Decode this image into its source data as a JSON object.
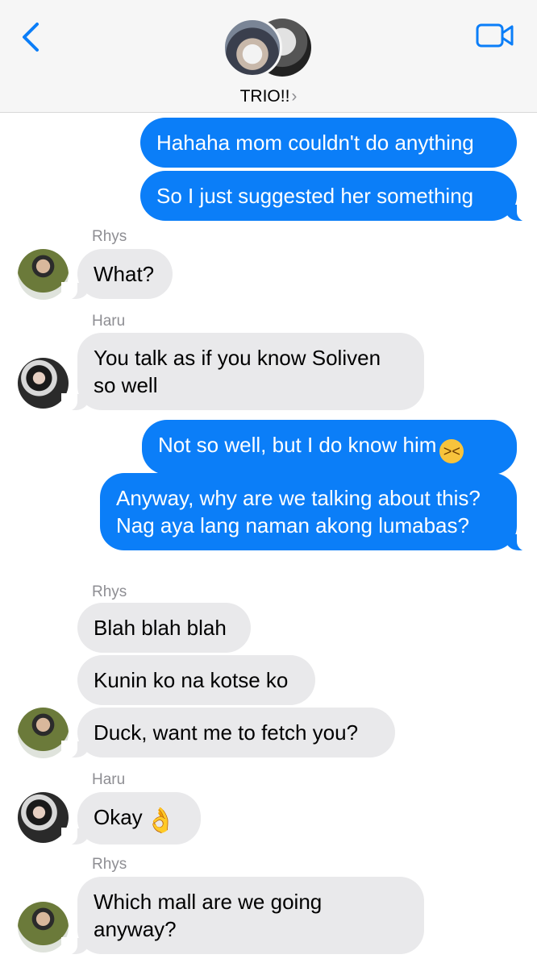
{
  "header": {
    "back_icon": "chevron-left-icon",
    "video_icon": "video-camera-icon",
    "group_name": "TRIO!!",
    "chevron": "›"
  },
  "colors": {
    "accent": "#0b7ef8",
    "incoming": "#e9e9eb",
    "sender_label": "#8e8e93"
  },
  "messages": [
    {
      "text": "Hahaha mom couldn't do anything",
      "direction": "outgoing"
    },
    {
      "text": "So I just suggested her something",
      "direction": "outgoing"
    },
    {
      "sender": "Rhys",
      "text": "What?",
      "direction": "incoming"
    },
    {
      "sender": "Haru",
      "text": "You talk as if you know Soliven so well",
      "direction": "incoming"
    },
    {
      "text": "Not so well, but I do know him",
      "emoji": "grinning-squinting-face-emoji",
      "direction": "outgoing"
    },
    {
      "text": "Anyway, why are we talking about this? Nag aya lang naman akong lumabas?",
      "direction": "outgoing"
    },
    {
      "sender": "Rhys",
      "text": "Blah blah blah",
      "direction": "incoming"
    },
    {
      "text": "Kunin ko na kotse ko",
      "direction": "incoming"
    },
    {
      "text": "Duck, want me to fetch you?",
      "direction": "incoming"
    },
    {
      "sender": "Haru",
      "text": "Okay",
      "emoji": "ok-hand-emoji",
      "direction": "incoming"
    },
    {
      "sender": "Rhys",
      "text": "Which mall are we going anyway?",
      "direction": "incoming"
    }
  ]
}
